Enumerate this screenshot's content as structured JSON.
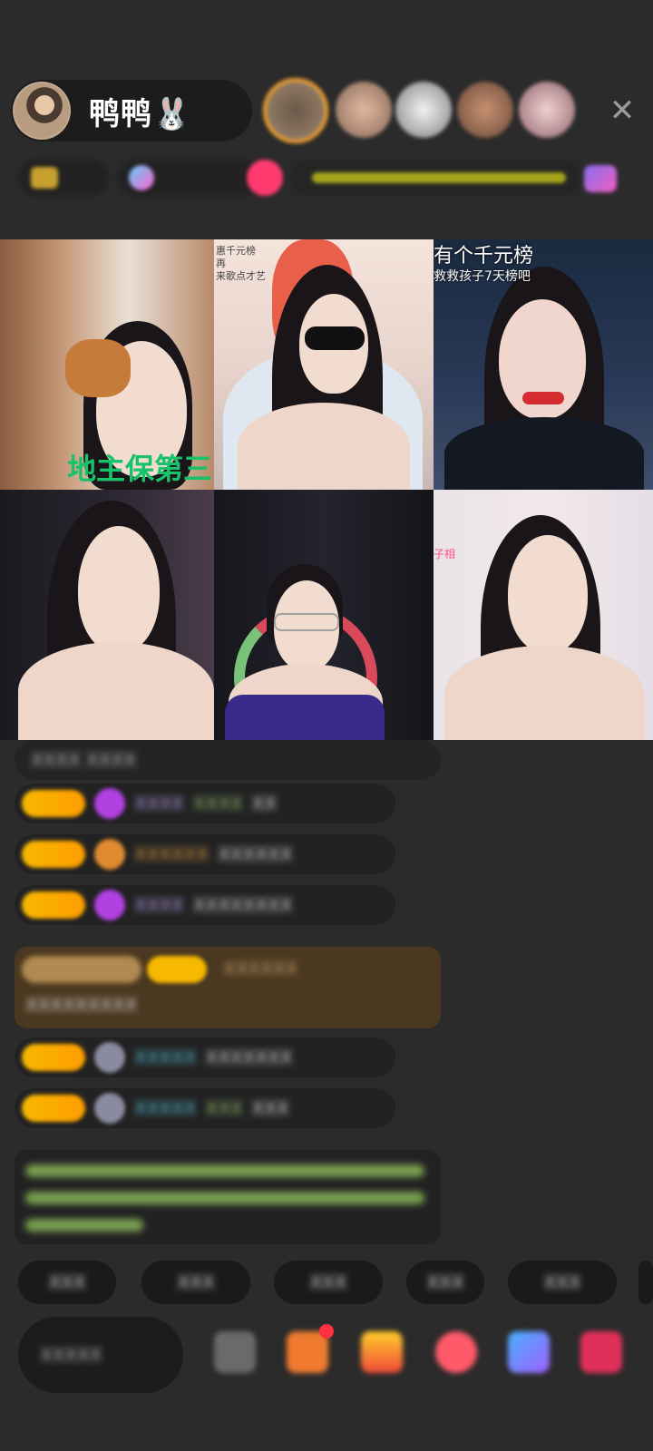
{
  "header": {
    "host_name": "鸭鸭🐰",
    "close_icon": "close-icon"
  },
  "grid": {
    "tile1_overlay": "地主保第三",
    "tile2_overlay_lines": [
      "惠千元榜",
      "再",
      "来歌点才艺"
    ],
    "tile3_overlay_lines": [
      "有个千元榜",
      "救救孩子7天榜吧"
    ],
    "tile6_overlay": "子相"
  },
  "colors": {
    "background": "#2b2b2b",
    "level_badge": "#f7b800",
    "gift_box": "#4a3820",
    "green_overlay": "#18c26a"
  },
  "icons": {
    "host_avatar": "host-avatar",
    "viewer_avatars": "viewer-avatar",
    "gift": "gift-icon",
    "emoji": "emoji-icon"
  }
}
